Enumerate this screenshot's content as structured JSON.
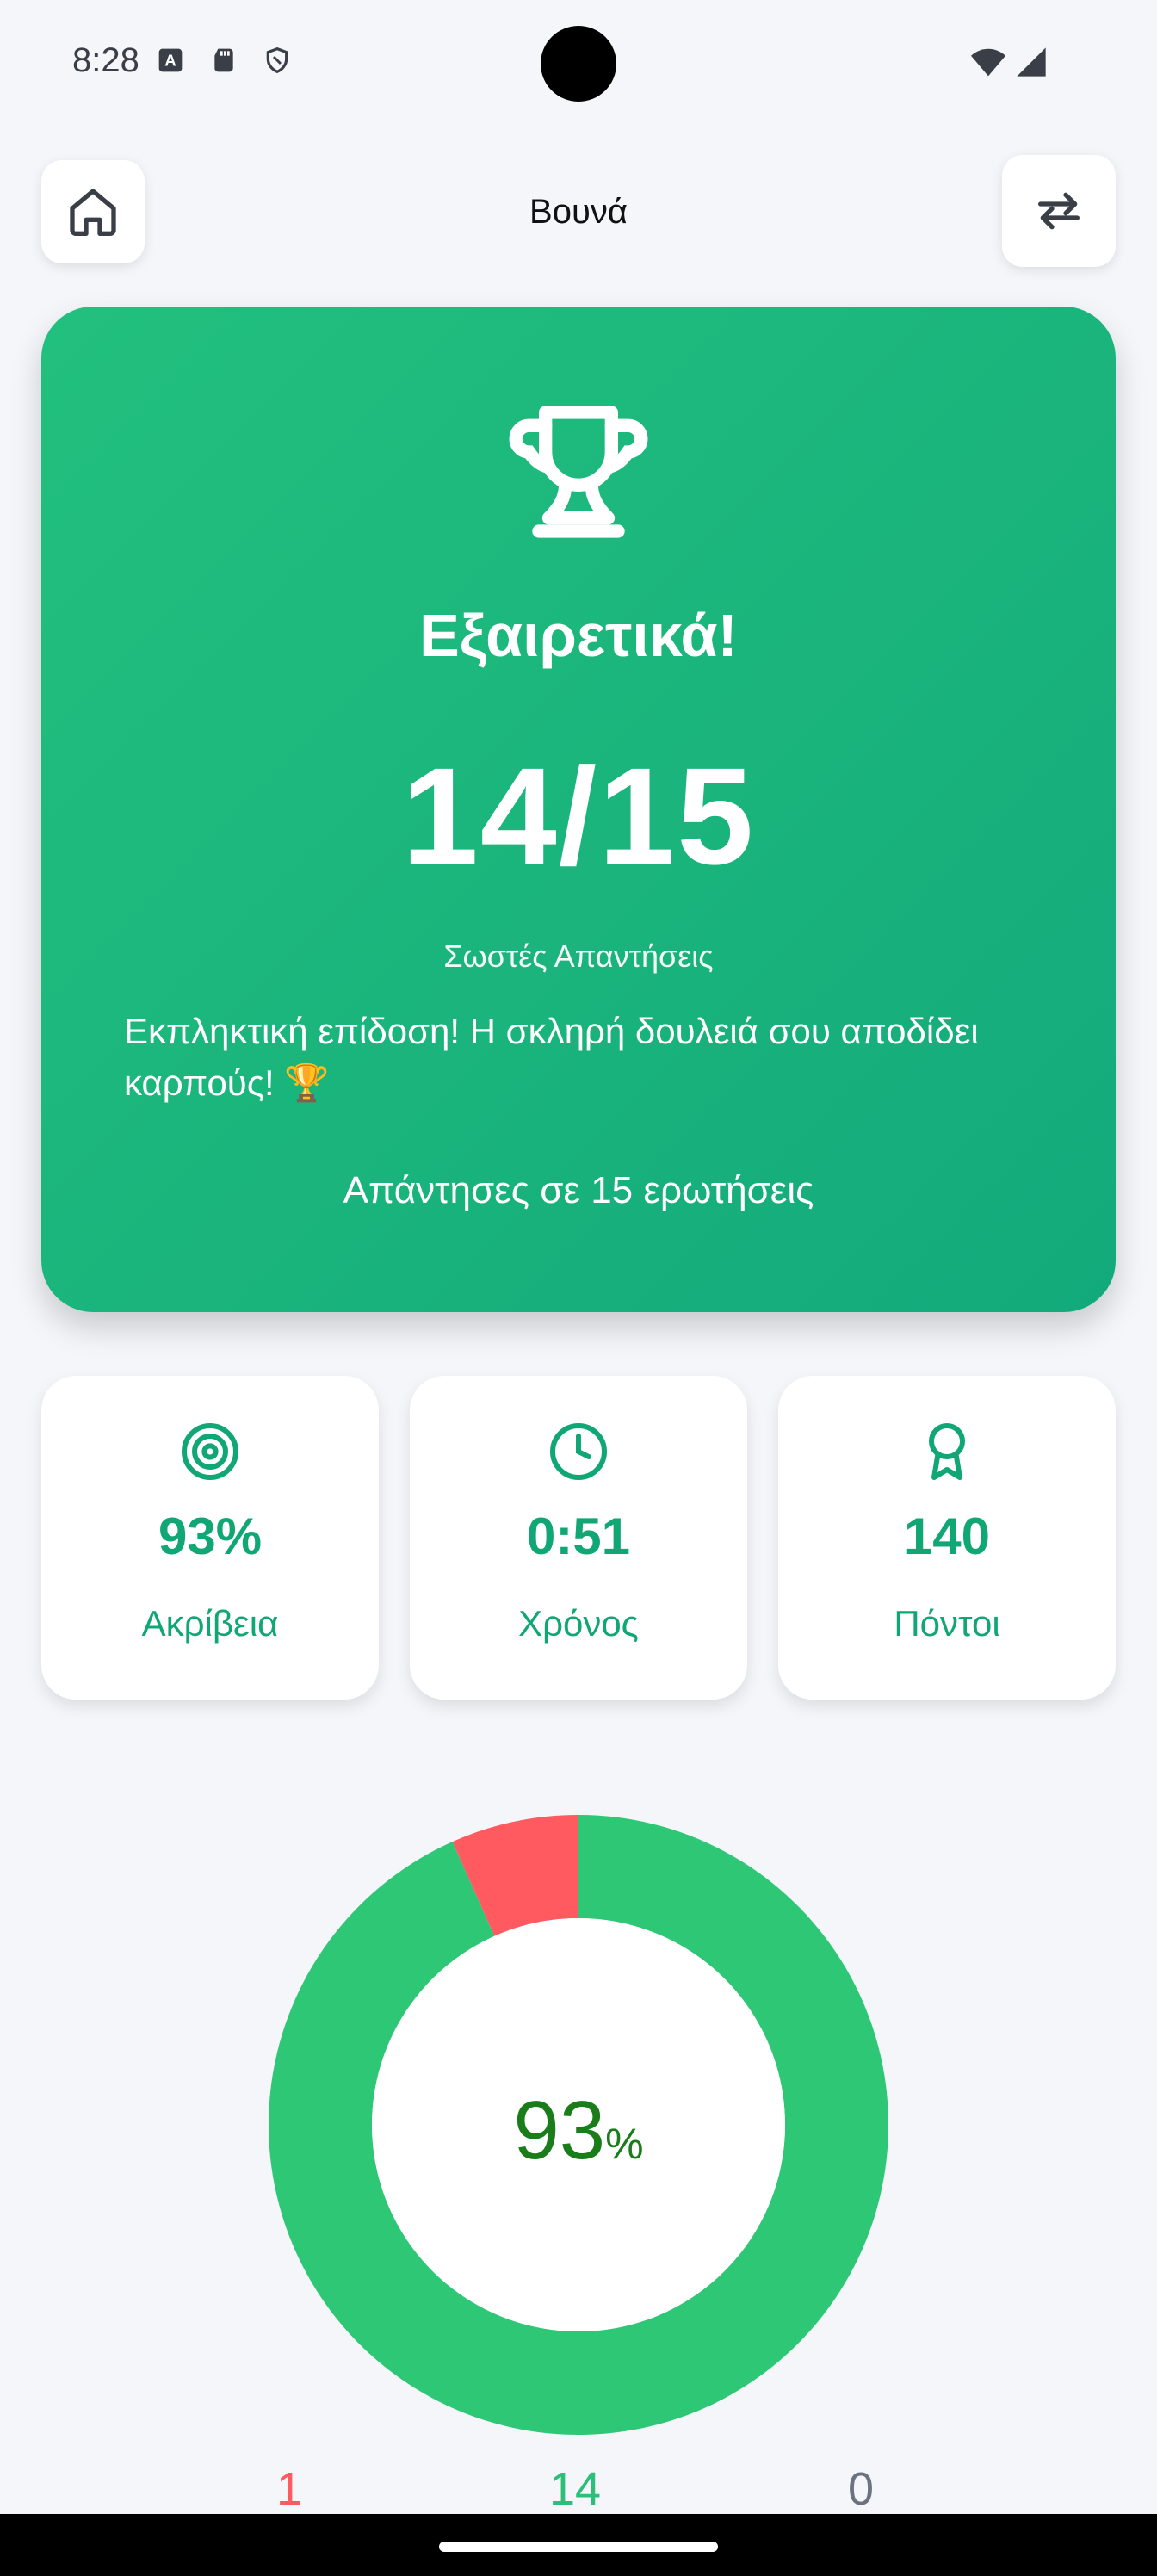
{
  "status_bar": {
    "time": "8:28",
    "icons_left": [
      "a-notification-icon",
      "sd-card-icon",
      "shield-icon"
    ],
    "icons_right": [
      "wifi-icon",
      "signal-icon"
    ]
  },
  "header": {
    "title": "Βουνά",
    "home_icon": "home-icon",
    "swap_icon": "swap-icon"
  },
  "result": {
    "headline": "Εξαιρετικά!",
    "score": "14/15",
    "score_label": "Σωστές Απαντήσεις",
    "message": "Εκπληκτική επίδοση! Η σκληρή δουλειά σου αποδίδει καρπούς! 🏆",
    "answered": "Απάντησες σε 15 ερωτήσεις",
    "trophy_icon": "trophy-icon"
  },
  "stats": [
    {
      "icon": "target-icon",
      "value": "93%",
      "label": "Ακρίβεια"
    },
    {
      "icon": "clock-icon",
      "value": "0:51",
      "label": "Χρόνος"
    },
    {
      "icon": "award-icon",
      "value": "140",
      "label": "Πόντοι"
    }
  ],
  "donut": {
    "center_value": "93",
    "center_unit": "%",
    "wrong": 1,
    "correct": 14,
    "skipped": 0,
    "colors": {
      "correct": "#2ec775",
      "wrong": "#ff5a5f",
      "skipped": "#9ca3af"
    }
  },
  "legend": {
    "wrong": "1",
    "correct": "14",
    "skipped": "0"
  },
  "colors": {
    "accent": "#13aa7b",
    "card_gradient_start": "#22c07e",
    "card_gradient_end": "#13aa7b",
    "background": "#f4f6fa"
  }
}
